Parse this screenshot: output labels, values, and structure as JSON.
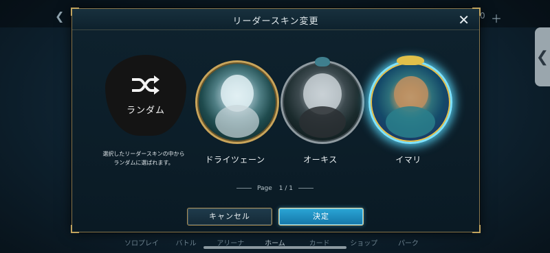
{
  "dialog": {
    "title": "リーダースキン変更",
    "close_glyph": "✕"
  },
  "skins": [
    {
      "id": "random",
      "label": "ランダム",
      "icon": "shuffle-icon",
      "selected": false
    },
    {
      "id": "drei",
      "label": "ドライツェーン",
      "selected": false
    },
    {
      "id": "okis",
      "label": "オーキス",
      "selected": false
    },
    {
      "id": "imari",
      "label": "イマリ",
      "selected": true
    }
  ],
  "random_description": "選択したリーダースキンの中から\nランダムに選ばれます。",
  "pagination": {
    "label": "Page",
    "current": "1",
    "separator": "/",
    "total": "1"
  },
  "buttons": {
    "cancel": "キャンセル",
    "confirm": "決定"
  },
  "background": {
    "nav_items": [
      "ソロプレイ",
      "バトル",
      "アリーナ",
      "ホーム",
      "カード",
      "ショップ",
      "パーク"
    ],
    "active_nav": "ホーム",
    "currency_value": "0"
  },
  "colors": {
    "accent_gold": "#c9a45a",
    "confirm_blue": "#1f8fc4",
    "selected_glow": "#5adcff"
  }
}
